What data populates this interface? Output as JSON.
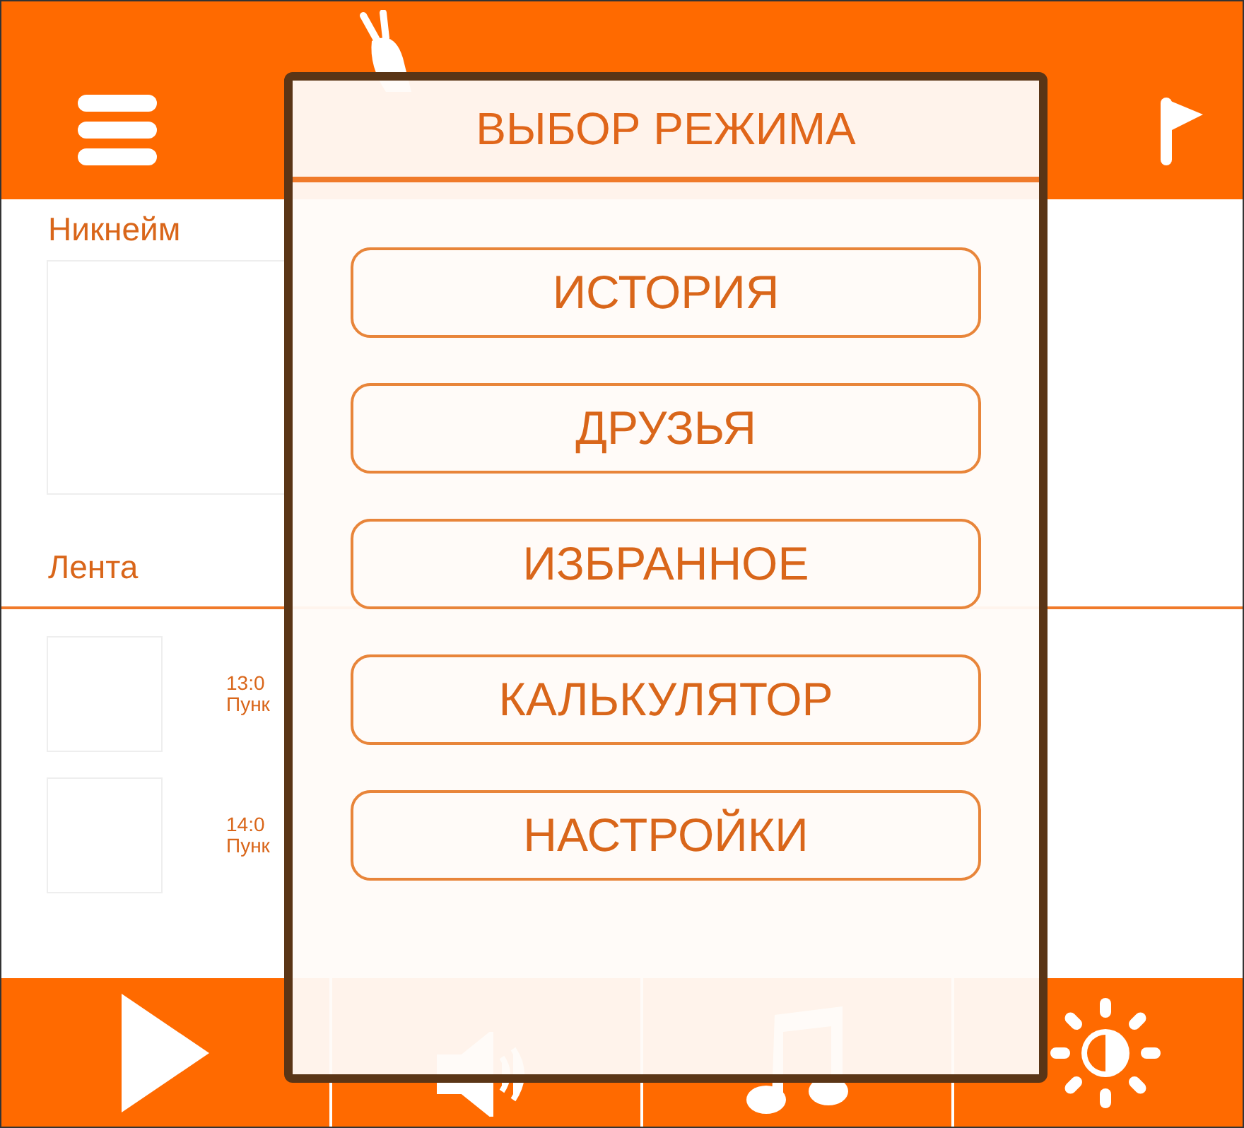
{
  "profile": {
    "nickname_label": "Никнейм"
  },
  "feed": {
    "label": "Лента",
    "items": [
      {
        "time": "13:0",
        "text": "Пунк"
      },
      {
        "time": "14:0",
        "text": "Пунк"
      }
    ]
  },
  "mode_dialog": {
    "title": "ВЫБОР РЕЖИМА",
    "options": [
      "ИСТОРИЯ",
      "ДРУЗЬЯ",
      "ИЗБРАННОЕ",
      "КАЛЬКУЛЯТОР",
      "НАСТРОЙКИ"
    ]
  }
}
